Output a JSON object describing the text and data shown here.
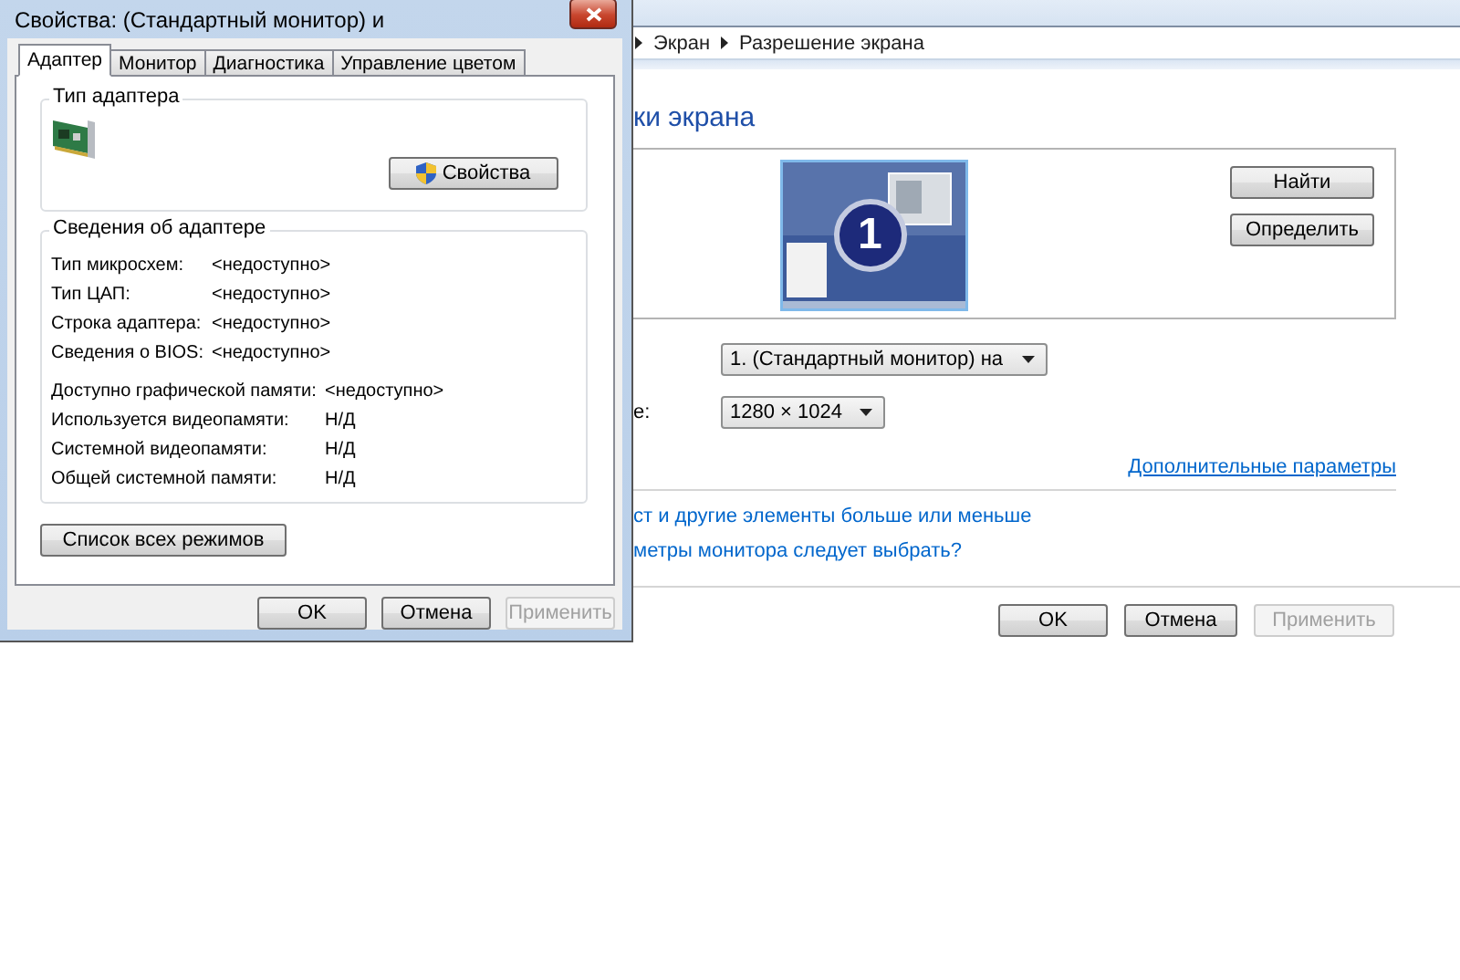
{
  "background_window": {
    "breadcrumb": [
      {
        "label": "Экран"
      },
      {
        "label": "Разрешение экрана"
      }
    ],
    "heading": "ки экрана",
    "monitor_number": "1",
    "side_buttons": [
      {
        "label": "Найти"
      },
      {
        "label": "Определить"
      }
    ],
    "settings": [
      {
        "value": "1. (Стандартный монитор) на"
      },
      {
        "label": "е:",
        "value": "1280 × 1024"
      }
    ],
    "advanced_link": "Дополнительные параметры",
    "links": [
      "ст и другие элементы больше или меньше",
      "метры монитора следует выбрать?"
    ],
    "buttons": [
      {
        "label": "OK",
        "disabled": false
      },
      {
        "label": "Отмена",
        "disabled": false
      },
      {
        "label": "Применить",
        "disabled": true
      }
    ]
  },
  "dialog": {
    "title": "Свойства: (Стандартный монитор) и",
    "tabs": [
      {
        "label": "Адаптер",
        "selected": true
      },
      {
        "label": "Монитор",
        "selected": false
      },
      {
        "label": "Диагностика",
        "selected": false
      },
      {
        "label": "Управление цветом",
        "selected": false
      }
    ],
    "adapter_type_group": "Тип адаптера",
    "properties_button": "Свойства",
    "info_group": "Сведения об адаптере",
    "info_rows": [
      {
        "label": "Тип микросхем:",
        "value": "<недоступно>"
      },
      {
        "label": "Тип ЦАП:",
        "value": "<недоступно>"
      },
      {
        "label": "Строка адаптера:",
        "value": "<недоступно>"
      },
      {
        "label": "Сведения о BIOS:",
        "value": "<недоступно>"
      }
    ],
    "memory_rows": [
      {
        "label": "Доступно графической памяти:",
        "value": "<недоступно>"
      },
      {
        "label": "Используется видеопамяти:",
        "value": "Н/Д"
      },
      {
        "label": "Системной видеопамяти:",
        "value": "Н/Д"
      },
      {
        "label": "Общей системной памяти:",
        "value": "Н/Д"
      }
    ],
    "list_modes_button": "Список всех режимов",
    "buttons": [
      {
        "label": "OK",
        "disabled": false
      },
      {
        "label": "Отмена",
        "disabled": false
      },
      {
        "label": "Применить",
        "disabled": true
      }
    ]
  }
}
